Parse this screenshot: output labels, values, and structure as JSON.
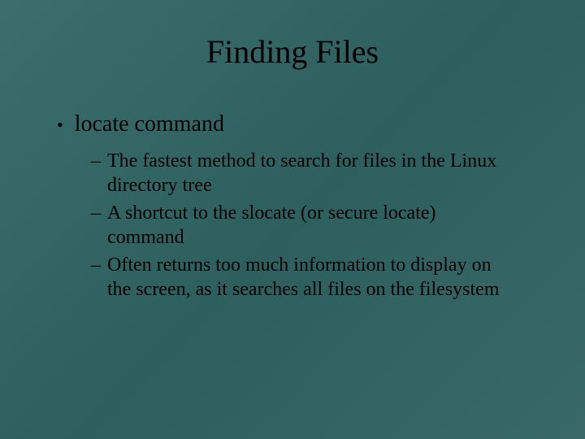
{
  "slide": {
    "title": "Finding Files",
    "bullets": [
      {
        "text": "locate command",
        "children": [
          "The fastest method to search for files in the Linux directory tree",
          "A shortcut to the slocate (or secure locate) command",
          "Often returns too much information to display on the screen, as it searches all files on the filesystem"
        ]
      }
    ]
  }
}
